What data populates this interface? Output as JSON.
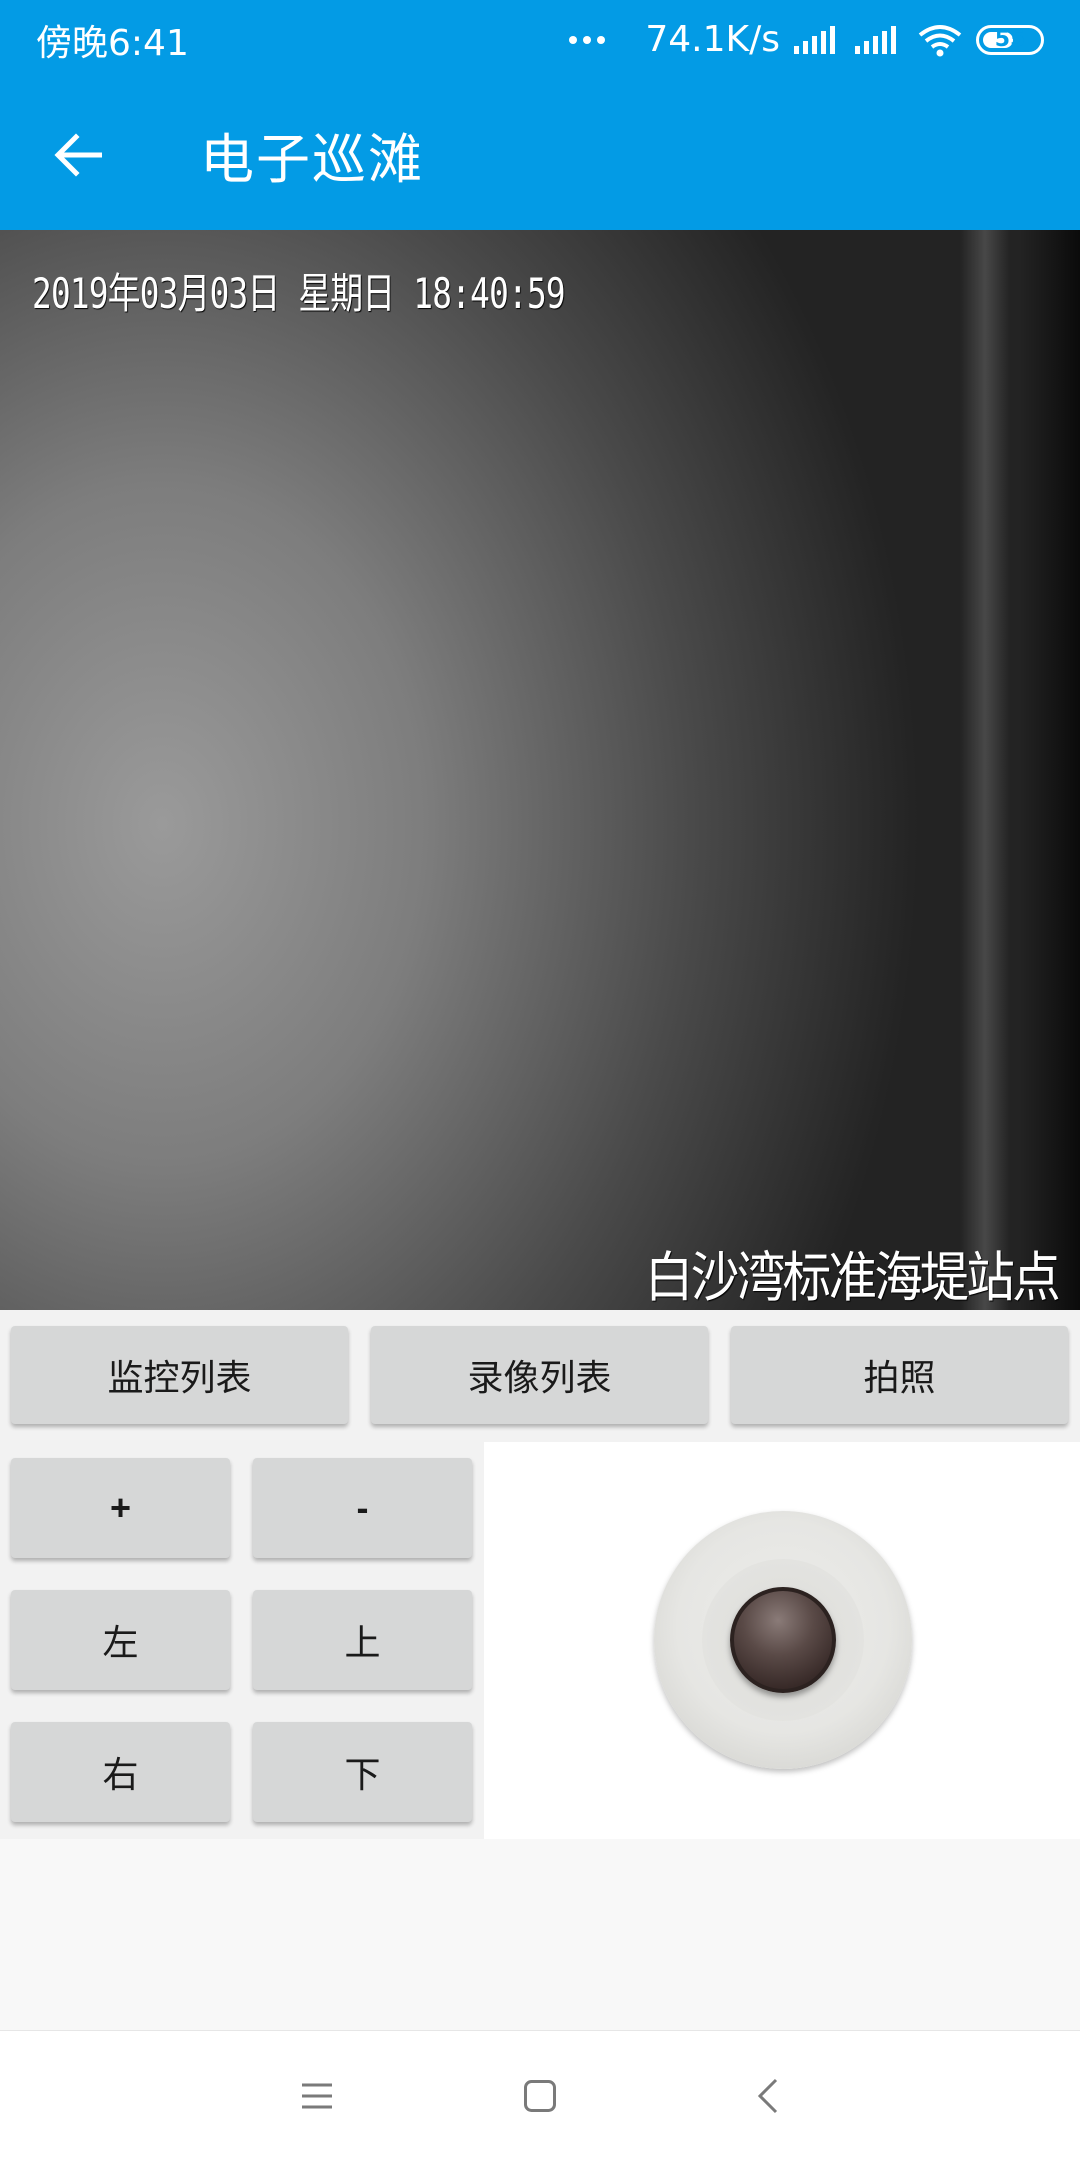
{
  "status_bar": {
    "time": "傍晚6:41",
    "network_speed": "74.1K/s",
    "battery_level": "55",
    "icons": [
      "more-dots-icon",
      "signal-icon",
      "signal-icon",
      "wifi-icon",
      "battery-icon"
    ]
  },
  "app_bar": {
    "title": "电子巡滩",
    "back_icon": "arrow-left-icon"
  },
  "video": {
    "timestamp": "2019年03月03日 星期日 18:40:59",
    "station_name": "白沙湾标准海堤站点"
  },
  "actions": {
    "monitor_list": "监控列表",
    "recording_list": "录像列表",
    "photo": "拍照"
  },
  "controls": {
    "zoom_in": "+",
    "zoom_out": "-",
    "left": "左",
    "up": "上",
    "right": "右",
    "down": "下"
  },
  "joystick": {
    "icon": "joystick-icon"
  },
  "nav_bar": {
    "icons": [
      "menu-icon",
      "home-icon",
      "back-icon"
    ]
  },
  "colors": {
    "primary": "#039be5",
    "button_bg": "#d6d7d7"
  }
}
